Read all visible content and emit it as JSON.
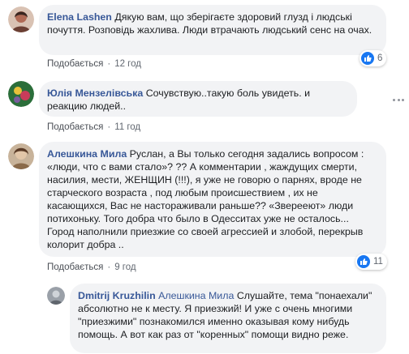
{
  "comments": [
    {
      "author": "Elena Lashen",
      "text": "Дякую вам, що зберігаєте здоровий глузд і людські почуття. Розповідь жахлива. Люди втрачають людський сенс на очах.",
      "action_like": "Подобається",
      "time": "12 год",
      "reaction_count": "6",
      "avatar_color": "#b06a55"
    },
    {
      "author": "Юлія Мензелівська",
      "text": "Сочувствую..такую боль увидеть. и реакцию людей..",
      "action_like": "Подобається",
      "time": "11 год",
      "avatar_color": "#7a5c9e"
    },
    {
      "author": "Алешкина Мила",
      "text": "Руслан, а Вы только сегодня задались вопросом : «люди, что с вами стало»? ?? А комментарии , жаждущих смерти, насилия, мести, ЖЕНЩИН (!!!), я уже не говорю о парнях, вроде не старческого возраста , под любым происшествием , их не касающихся, Вас не настораживали раньше?? «Зверееют» люди потихоньку. Того добра что было в Одесситах уже не осталось... Город наполнили приезжие со своей агрессией и злобой, перекрыв колорит добра ..",
      "action_like": "Подобається",
      "time": "9 год",
      "reaction_count": "11",
      "avatar_color": "#8a6a4a"
    }
  ],
  "reply": {
    "author": "Dmitrij Kruzhilin",
    "mention": "Алешкина Мила",
    "text": "Слушайте, тема \"понаехали\" абсолютно не к месту. Я приезжий! И уже с очень многими \"приезжими\" познакомился именно оказывая кому нибудь помощь. А вот как раз от \"коренных\" помощи видно реже.",
    "avatar_color": "#9aa0a8"
  },
  "colors": {
    "link": "#385898",
    "bubble": "#f2f3f5",
    "like_blue": "#1877f2"
  }
}
